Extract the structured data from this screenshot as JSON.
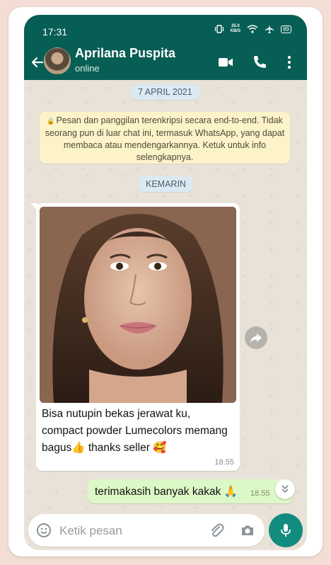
{
  "status_bar": {
    "time": "17:31",
    "net_speed_value": "25.0",
    "net_speed_unit": "KB/S",
    "battery": "89"
  },
  "header": {
    "contact_name": "Aprilana Puspita",
    "contact_status": "online",
    "icons": [
      "back-arrow-icon",
      "video-call-icon",
      "phone-icon",
      "more-vert-icon"
    ]
  },
  "chat": {
    "date_1": "7 APRIL 2021",
    "encryption_notice": "Pesan dan panggilan terenkripsi secara end-to-end. Tidak seorang pun di luar chat ini, termasuk WhatsApp, yang dapat membaca atau mendengarkannya. Ketuk untuk info selengkapnya.",
    "date_2": "KEMARIN",
    "incoming": {
      "caption": "Bisa nutupin bekas jerawat ku, compact powder Lumecolors memang bagus👍 thanks seller 🥰",
      "time": "18.55"
    },
    "outgoing": {
      "text": "terimakasih banyak kakak 🙏",
      "time": "18.55"
    }
  },
  "input_bar": {
    "placeholder": "Ketik pesan",
    "icons": [
      "emoji-icon",
      "attach-icon",
      "camera-icon",
      "mic-icon"
    ]
  },
  "colors": {
    "header": "#075e54",
    "mic_button": "#128c7e",
    "outgoing_bubble": "#dcf8c6",
    "encryption_bg": "#fcf3c8",
    "date_pill": "#dbe9f3"
  }
}
